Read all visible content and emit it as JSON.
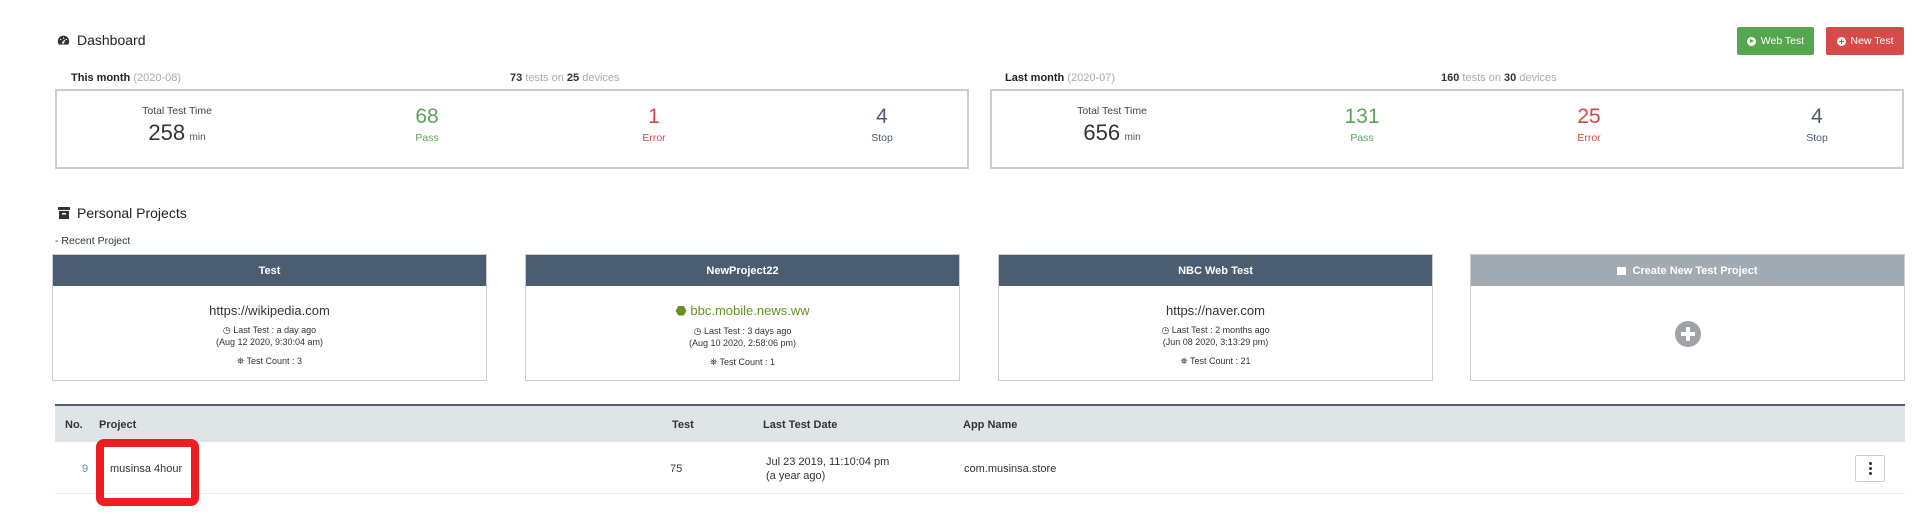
{
  "header": {
    "title": "Dashboard",
    "web_test_label": "Web Test",
    "new_test_label": "New Test"
  },
  "this_month": {
    "label": "This month",
    "period": "(2020-08)",
    "tests": "73",
    "tests_word": "tests on",
    "devices": "25",
    "devices_word": "devices",
    "total_label": "Total Test Time",
    "total_value": "258",
    "total_unit": "min",
    "pass": "68",
    "pass_label": "Pass",
    "error": "1",
    "error_label": "Error",
    "stop": "4",
    "stop_label": "Stop"
  },
  "last_month": {
    "label": "Last month",
    "period": "(2020-07)",
    "tests": "160",
    "tests_word": "tests on",
    "devices": "30",
    "devices_word": "devices",
    "total_label": "Total Test Time",
    "total_value": "656",
    "total_unit": "min",
    "pass": "131",
    "pass_label": "Pass",
    "error": "25",
    "error_label": "Error",
    "stop": "4",
    "stop_label": "Stop"
  },
  "projects": {
    "title": "Personal Projects",
    "recent_label": "- Recent Project",
    "cards": [
      {
        "name": "Test",
        "url": "https://wikipedia.com",
        "last_test": "Last Test : a day ago",
        "date": "(Aug 12 2020, 9:30:04 am)",
        "count": "Test Count : 3"
      },
      {
        "name": "NewProject22",
        "url": "bbc.mobile.news.ww",
        "last_test": "Last Test : 3 days ago",
        "date": "(Aug 10 2020, 2:58:06 pm)",
        "count": "Test Count : 1"
      },
      {
        "name": "NBC Web Test",
        "url": "https://naver.com",
        "last_test": "Last Test : 2 months ago",
        "date": "(Jun 08 2020, 3:13:29 pm)",
        "count": "Test Count : 21"
      }
    ],
    "create_label": "Create New Test Project"
  },
  "table": {
    "headers": {
      "no": "No.",
      "project": "Project",
      "test": "Test",
      "last_test_date": "Last Test Date",
      "app_name": "App Name"
    },
    "rows": [
      {
        "no": "9",
        "project": "musinsa 4hour",
        "test": "75",
        "date": "Jul 23 2019, 11:10:04 pm",
        "relative": "(a year ago)",
        "app": "com.musinsa.store"
      }
    ]
  },
  "colors": {
    "green": "#5aa55a",
    "red": "#d04848",
    "slate": "#4b5d71",
    "highlight": "#f01c22"
  }
}
